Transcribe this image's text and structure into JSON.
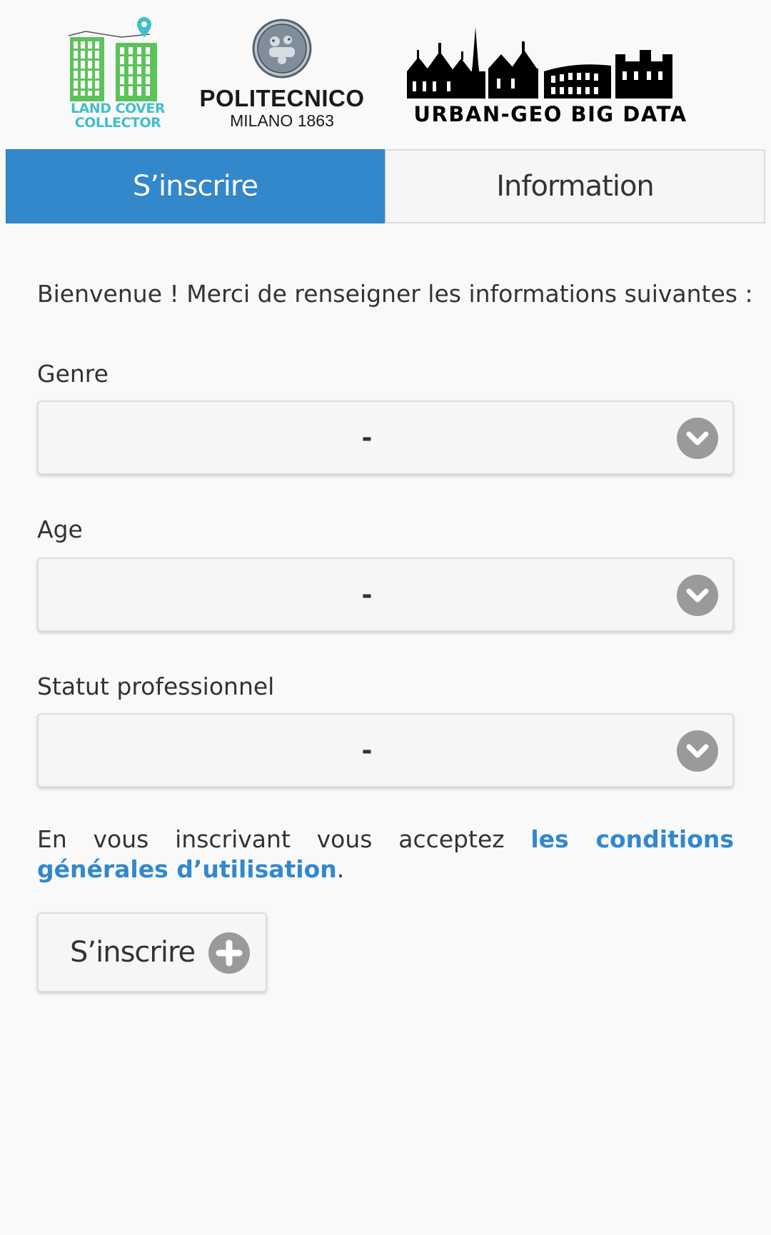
{
  "logos": {
    "land_cover": {
      "line1": "LAND COVER",
      "line2": "COLLECTOR",
      "icon": "buildings-pin-icon"
    },
    "politecnico": {
      "name": "POLITECNICO",
      "sub": "MILANO 1863",
      "icon": "university-seal-icon"
    },
    "urban_geo": {
      "name": "URBAN-GEO BIG DATA",
      "icon": "city-skyline-icon"
    }
  },
  "tabs": [
    {
      "label": "S’inscrire",
      "active": true
    },
    {
      "label": "Information",
      "active": false
    }
  ],
  "form": {
    "intro": "Bienvenue ! Merci de renseigner les informations suivantes :",
    "fields": [
      {
        "label": "Genre",
        "value": "-"
      },
      {
        "label": "Age",
        "value": "-"
      },
      {
        "label": "Statut professionnel",
        "value": "-"
      }
    ],
    "terms": {
      "prefix": "En vous inscrivant vous acceptez ",
      "link": "les conditions générales d’utilisation",
      "suffix": "."
    },
    "submit_label": "S’inscrire"
  },
  "colors": {
    "accent": "#3388cc",
    "land_cover_green": "#5cc35a",
    "land_cover_teal": "#41bfc9",
    "icon_grey": "#9a9a9a"
  }
}
